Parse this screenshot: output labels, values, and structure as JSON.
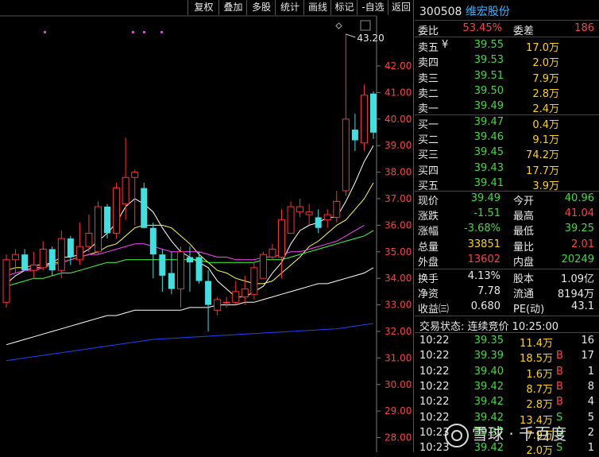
{
  "toolbar": {
    "buttons": [
      "复权",
      "叠加",
      "多股",
      "统计",
      "画线",
      "标记",
      "-自选",
      "返回"
    ]
  },
  "chart": {
    "price_ticks": [
      "42.00",
      "41.00",
      "40.00",
      "39.00",
      "38.00",
      "37.00",
      "36.00",
      "35.00",
      "34.00",
      "33.00",
      "32.00",
      "31.00",
      "30.00",
      "29.00",
      "28.00"
    ],
    "high_label": "43.20",
    "colors": {
      "up": "#ff3030",
      "down": "#40e0e0",
      "ma5": "#ffffff",
      "ma10": "#ffff40",
      "ma20": "#ff40ff",
      "ma30": "#40ff40",
      "ma60": "#ffffff",
      "ma120": "#2040ff"
    }
  },
  "chart_data": {
    "type": "candlestick",
    "ylim": [
      27.9,
      43.5
    ],
    "yticks": [
      42,
      41,
      40,
      39,
      38,
      37,
      36,
      35,
      34,
      33,
      32,
      31,
      30,
      29,
      28
    ],
    "candles": [
      {
        "o": 33.1,
        "h": 34.9,
        "l": 32.9,
        "c": 34.7
      },
      {
        "o": 34.7,
        "h": 35.1,
        "l": 34.2,
        "c": 34.9
      },
      {
        "o": 34.9,
        "h": 35.1,
        "l": 34.3,
        "c": 34.3
      },
      {
        "o": 34.3,
        "h": 35.0,
        "l": 34.0,
        "c": 34.5
      },
      {
        "o": 34.4,
        "h": 35.4,
        "l": 34.3,
        "c": 35.1
      },
      {
        "o": 35.1,
        "h": 35.2,
        "l": 34.1,
        "c": 34.3
      },
      {
        "o": 34.3,
        "h": 35.8,
        "l": 34.0,
        "c": 35.5
      },
      {
        "o": 35.5,
        "h": 35.6,
        "l": 34.5,
        "c": 34.8
      },
      {
        "o": 34.7,
        "h": 36.1,
        "l": 34.5,
        "c": 35.2
      },
      {
        "o": 35.2,
        "h": 36.4,
        "l": 35.0,
        "c": 35.7
      },
      {
        "o": 35.0,
        "h": 36.9,
        "l": 34.9,
        "c": 36.7
      },
      {
        "o": 36.7,
        "h": 36.8,
        "l": 35.5,
        "c": 35.7
      },
      {
        "o": 35.7,
        "h": 37.6,
        "l": 35.5,
        "c": 37.4
      },
      {
        "o": 36.8,
        "h": 39.3,
        "l": 36.2,
        "c": 37.8
      },
      {
        "o": 37.8,
        "h": 38.1,
        "l": 36.0,
        "c": 38.0
      },
      {
        "o": 37.4,
        "h": 37.6,
        "l": 35.9,
        "c": 35.9
      },
      {
        "o": 35.9,
        "h": 36.1,
        "l": 34.0,
        "c": 34.9
      },
      {
        "o": 34.9,
        "h": 35.1,
        "l": 33.5,
        "c": 34.1
      },
      {
        "o": 34.2,
        "h": 35.0,
        "l": 33.4,
        "c": 33.6
      },
      {
        "o": 33.6,
        "h": 35.2,
        "l": 32.9,
        "c": 35.0
      },
      {
        "o": 34.8,
        "h": 35.2,
        "l": 33.5,
        "c": 34.6
      },
      {
        "o": 34.8,
        "h": 35.0,
        "l": 33.8,
        "c": 33.9
      },
      {
        "o": 33.9,
        "h": 34.3,
        "l": 32.0,
        "c": 33.0
      },
      {
        "o": 32.8,
        "h": 33.3,
        "l": 32.6,
        "c": 33.2
      },
      {
        "o": 33.1,
        "h": 33.3,
        "l": 32.9,
        "c": 33.1
      },
      {
        "o": 33.1,
        "h": 33.9,
        "l": 33.0,
        "c": 33.5
      },
      {
        "o": 33.3,
        "h": 34.1,
        "l": 33.0,
        "c": 33.6
      },
      {
        "o": 33.4,
        "h": 34.6,
        "l": 33.2,
        "c": 34.4
      },
      {
        "o": 34.0,
        "h": 35.0,
        "l": 34.0,
        "c": 34.9
      },
      {
        "o": 34.8,
        "h": 35.3,
        "l": 34.7,
        "c": 35.1
      },
      {
        "o": 34.8,
        "h": 36.6,
        "l": 34.0,
        "c": 36.2
      },
      {
        "o": 35.7,
        "h": 36.9,
        "l": 35.7,
        "c": 36.7
      },
      {
        "o": 36.5,
        "h": 37.0,
        "l": 36.3,
        "c": 36.7
      },
      {
        "o": 36.4,
        "h": 36.8,
        "l": 36.0,
        "c": 36.5
      },
      {
        "o": 36.3,
        "h": 36.6,
        "l": 35.7,
        "c": 35.9
      },
      {
        "o": 36.2,
        "h": 36.6,
        "l": 35.9,
        "c": 36.4
      },
      {
        "o": 36.3,
        "h": 37.3,
        "l": 36.1,
        "c": 36.9
      },
      {
        "o": 37.3,
        "h": 43.2,
        "l": 37.1,
        "c": 40.0
      },
      {
        "o": 39.6,
        "h": 40.2,
        "l": 38.8,
        "c": 39.2
      },
      {
        "o": 39.1,
        "h": 41.3,
        "l": 38.8,
        "c": 40.9
      },
      {
        "o": 40.96,
        "h": 41.04,
        "l": 39.25,
        "c": 39.49
      }
    ],
    "ma_lines": [
      {
        "color": "#ffffff",
        "values": [
          33.8,
          34.1,
          34.3,
          34.4,
          34.4,
          34.6,
          34.8,
          34.8,
          34.9,
          35.1,
          35.4,
          35.7,
          36.1,
          36.7,
          37.0,
          36.8,
          36.5,
          35.9,
          35.4,
          35.0,
          34.8,
          34.6,
          34.4,
          33.9,
          33.6,
          33.3,
          33.3,
          33.5,
          33.7,
          34.2,
          34.6,
          35.3,
          35.8,
          36.0,
          36.1,
          36.3,
          36.3,
          36.9,
          37.6,
          38.4,
          39.0
        ]
      },
      {
        "color": "#ffff40",
        "values": [
          34.3,
          34.4,
          34.4,
          34.5,
          34.5,
          34.6,
          34.6,
          34.7,
          34.8,
          34.9,
          35.0,
          35.2,
          35.3,
          35.6,
          35.9,
          36.0,
          36.0,
          36.0,
          35.9,
          35.6,
          35.3,
          34.9,
          34.6,
          34.3,
          34.2,
          34.0,
          33.9,
          33.8,
          33.8,
          33.9,
          34.2,
          34.5,
          34.8,
          35.2,
          35.4,
          35.7,
          36.0,
          36.2,
          36.6,
          37.0,
          37.6
        ]
      },
      {
        "color": "#ff40ff",
        "values": [
          34.1,
          34.2,
          34.3,
          34.3,
          34.4,
          34.5,
          34.6,
          34.7,
          34.8,
          34.9,
          34.9,
          35.0,
          35.1,
          35.2,
          35.3,
          35.3,
          35.2,
          35.1,
          35.0,
          35.0,
          35.0,
          35.0,
          34.9,
          34.8,
          34.8,
          34.7,
          34.7,
          34.7,
          34.8,
          34.8,
          34.9,
          35.0,
          35.0,
          35.1,
          35.2,
          35.3,
          35.4,
          35.6,
          35.8,
          36.0
        ]
      },
      {
        "color": "#40ff40",
        "values": [
          33.7,
          33.8,
          33.9,
          34.0,
          34.0,
          34.1,
          34.2,
          34.2,
          34.3,
          34.4,
          34.5,
          34.6,
          34.6,
          34.7,
          34.7,
          34.7,
          34.7,
          34.7,
          34.7,
          34.7,
          34.7,
          34.7,
          34.6,
          34.6,
          34.6,
          34.6,
          34.6,
          34.6,
          34.7,
          34.7,
          34.7,
          34.8,
          34.9,
          35.0,
          35.1,
          35.2,
          35.3,
          35.4,
          35.5,
          35.6,
          35.8
        ]
      },
      {
        "color": "#ffffff",
        "values": [
          31.5,
          31.6,
          31.7,
          31.8,
          31.9,
          32.0,
          32.1,
          32.2,
          32.3,
          32.4,
          32.5,
          32.6,
          32.6,
          32.7,
          32.8,
          32.8,
          32.8,
          32.8,
          32.8,
          32.8,
          32.9,
          32.9,
          32.9,
          33.0,
          33.0,
          33.0,
          33.1,
          33.1,
          33.2,
          33.3,
          33.4,
          33.5,
          33.6,
          33.7,
          33.8,
          33.8,
          33.9,
          34.0,
          34.1,
          34.2,
          34.4
        ]
      },
      {
        "color": "#2040ff",
        "values": [
          30.9,
          30.95,
          31.0,
          31.05,
          31.1,
          31.15,
          31.2,
          31.25,
          31.3,
          31.35,
          31.4,
          31.45,
          31.5,
          31.55,
          31.6,
          31.65,
          31.7,
          31.72,
          31.74,
          31.76,
          31.78,
          31.8,
          31.82,
          31.84,
          31.86,
          31.88,
          31.9,
          31.92,
          31.94,
          31.96,
          31.98,
          32.0,
          32.02,
          32.04,
          32.06,
          32.08,
          32.1,
          32.15,
          32.2,
          32.25,
          32.3
        ]
      }
    ]
  },
  "quote": {
    "code": "300508",
    "name": "维宏股份",
    "webi_label": "委比",
    "webi_value": "53.45%",
    "wecha_label": "委差",
    "wecha_value": "186",
    "sells": [
      {
        "label": "卖五",
        "mark": "¥",
        "price": "39.55",
        "vol": "17.0万"
      },
      {
        "label": "卖四",
        "mark": "",
        "price": "39.53",
        "vol": "2.0万"
      },
      {
        "label": "卖三",
        "mark": "",
        "price": "39.51",
        "vol": "7.9万"
      },
      {
        "label": "卖二",
        "mark": "",
        "price": "39.50",
        "vol": "2.8万"
      },
      {
        "label": "卖一",
        "mark": "",
        "price": "39.49",
        "vol": "2.4万"
      }
    ],
    "buys": [
      {
        "label": "买一",
        "price": "39.47",
        "vol": "0.4万"
      },
      {
        "label": "买二",
        "price": "39.46",
        "vol": "9.1万"
      },
      {
        "label": "买三",
        "price": "39.45",
        "vol": "74.2万"
      },
      {
        "label": "买四",
        "price": "39.43",
        "vol": "17.7万"
      },
      {
        "label": "买五",
        "price": "39.41",
        "vol": "3.9万"
      }
    ],
    "stats": [
      {
        "l1": "现价",
        "v1": "39.49",
        "c1": "down",
        "l2": "今开",
        "v2": "40.96",
        "c2": "down"
      },
      {
        "l1": "涨跌",
        "v1": "-1.51",
        "c1": "down",
        "l2": "最高",
        "v2": "41.04",
        "c2": "up"
      },
      {
        "l1": "涨幅",
        "v1": "-3.68%",
        "c1": "down",
        "l2": "最低",
        "v2": "39.25",
        "c2": "down"
      },
      {
        "l1": "总量",
        "v1": "33851",
        "c1": "yl",
        "l2": "量比",
        "v2": "2.01",
        "c2": "up"
      },
      {
        "l1": "外盘",
        "v1": "13602",
        "c1": "up",
        "l2": "内盘",
        "v2": "20249",
        "c2": "down"
      }
    ],
    "fund": [
      {
        "l1": "换手",
        "v1": "4.13%",
        "l2": "股本",
        "v2": "1.09亿"
      },
      {
        "l1": "净资",
        "v1": "7.78",
        "l2": "流通",
        "v2": "8194万"
      },
      {
        "l1": "收益㈢",
        "v1": "0.680",
        "l2": "PE(动)",
        "v2": "43.1"
      }
    ],
    "trade_status": "交易状态: 连续竞价 10:25:00",
    "ticks": [
      {
        "t": "10:22",
        "p": "39.35",
        "v": "11.4万",
        "s": "",
        "n": "16"
      },
      {
        "t": "10:22",
        "p": "39.39",
        "v": "18.5万",
        "s": "B",
        "n": "17"
      },
      {
        "t": "10:22",
        "p": "39.40",
        "v": "1.6万",
        "s": "B",
        "n": "1"
      },
      {
        "t": "10:22",
        "p": "39.42",
        "v": "8.7万",
        "s": "B",
        "n": "8"
      },
      {
        "t": "10:22",
        "p": "39.42",
        "v": "2.8万",
        "s": "B",
        "n": "4"
      },
      {
        "t": "10:22",
        "p": "39.42",
        "v": "13.4万",
        "s": "S",
        "n": "5"
      },
      {
        "t": "10:23",
        "p": "39.37",
        "v": "7.9万",
        "s": "S",
        "n": "2"
      },
      {
        "t": "10:23",
        "p": "39.42",
        "v": "2.0万",
        "s": "S",
        "n": "1"
      }
    ]
  },
  "watermark": {
    "text": "雪球 · 千百度"
  }
}
